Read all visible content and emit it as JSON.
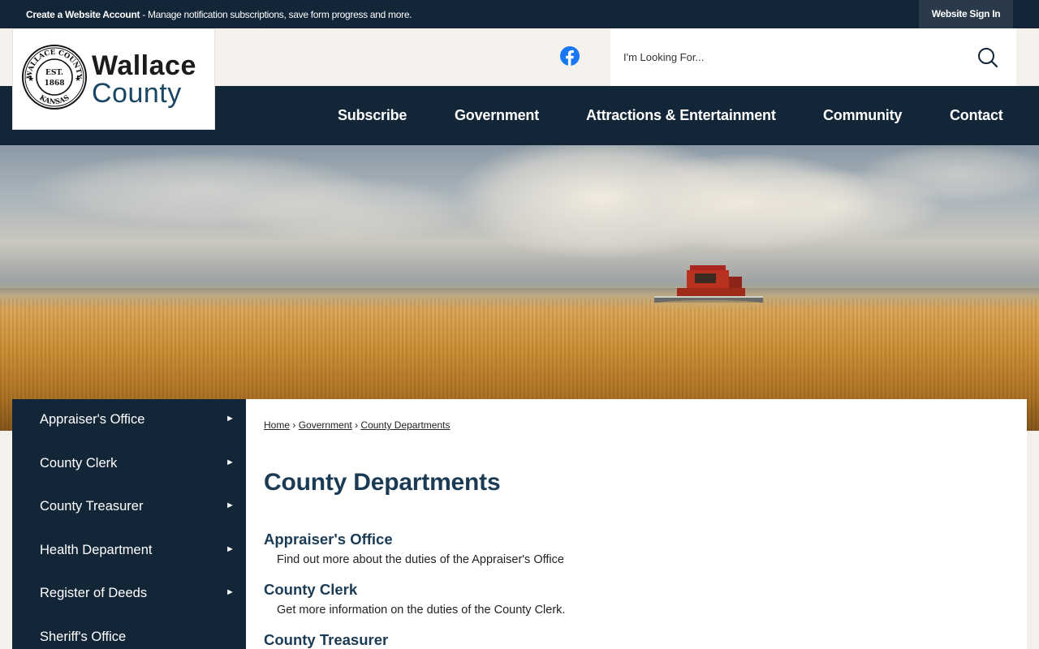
{
  "topbar": {
    "create_label": "Create a Website Account",
    "create_desc": " - Manage notification subscriptions, save form progress and more.",
    "signin_label": "Website Sign In"
  },
  "logo": {
    "word1": "Wallace",
    "word2": "County",
    "seal_top": "WALLACE COUNTY",
    "seal_bottom": "KANSAS",
    "seal_est": "EST.",
    "seal_year": "1868"
  },
  "search": {
    "placeholder": "I'm Looking For..."
  },
  "nav": {
    "items": [
      {
        "label": "Subscribe"
      },
      {
        "label": "Government"
      },
      {
        "label": "Attractions & Entertainment"
      },
      {
        "label": "Community"
      },
      {
        "label": "Contact"
      }
    ]
  },
  "sidebar": {
    "items": [
      {
        "label": "Appraiser's Office"
      },
      {
        "label": "County Clerk"
      },
      {
        "label": "County Treasurer"
      },
      {
        "label": "Health Department"
      },
      {
        "label": "Register of Deeds"
      },
      {
        "label": "Sheriff's Office"
      }
    ],
    "arrow": "►"
  },
  "breadcrumb": {
    "items": [
      "Home",
      "Government",
      "County Departments"
    ],
    "separator": "›"
  },
  "main": {
    "title": "County Departments",
    "departments": [
      {
        "title": "Appraiser's Office",
        "desc": "Find out more about the duties of the Appraiser's Office"
      },
      {
        "title": "County Clerk",
        "desc": "Get more information on the duties of the County Clerk."
      },
      {
        "title": "County Treasurer",
        "desc": ""
      }
    ]
  },
  "colors": {
    "navy": "#132638",
    "heading": "#1b3b55",
    "facebook": "#1877f2",
    "background": "#f4f1ec"
  },
  "icons": [
    "facebook-icon",
    "search-icon",
    "county-seal-logo",
    "right-arrow-icon"
  ]
}
